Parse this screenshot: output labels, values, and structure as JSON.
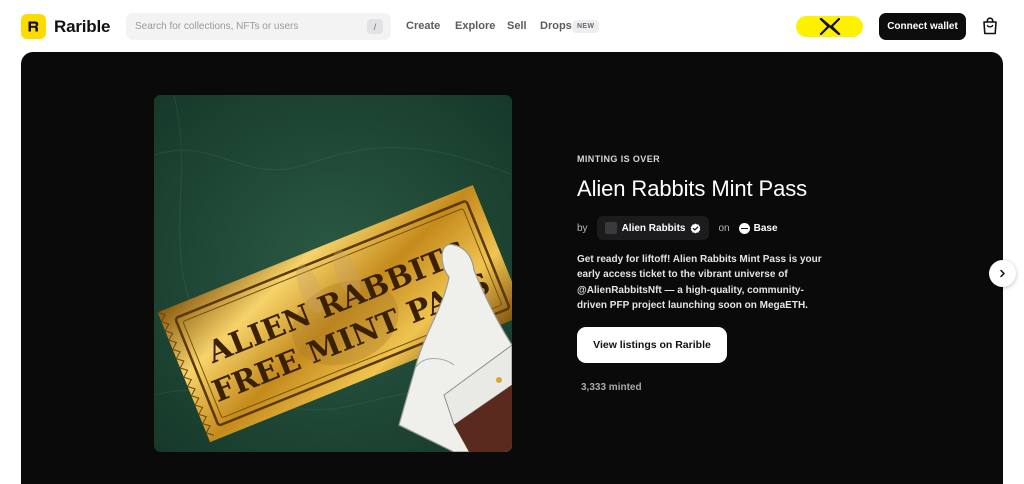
{
  "brand": {
    "name": "Rarible",
    "accent": "#FEDA03"
  },
  "search": {
    "placeholder": "Search for collections, NFTs or users",
    "shortcut": "/"
  },
  "nav": {
    "create": "Create",
    "explore": "Explore",
    "sell": "Sell",
    "drops": "Drops",
    "drops_badge": "NEW"
  },
  "header": {
    "x_button_icon": "x-logo-icon",
    "x_pill_color": "#FEF100",
    "connect_label": "Connect wallet",
    "cart_icon": "shopping-bag-icon"
  },
  "hero": {
    "status": "MINTING IS OVER",
    "title": "Alien Rabbits Mint Pass",
    "by_label": "by",
    "creator": "Alien Rabbits",
    "creator_verified": true,
    "on_label": "on",
    "chain": "Base",
    "description": "Get ready for liftoff! Alien Rabbits Mint Pass is your early access ticket to the vibrant universe of @AlienRabbitsNft — a high-quality, community-driven PFP project launching soon on MegaETH.",
    "cta_label": "View listings on Rarible",
    "minted": "3,333 minted",
    "artwork": {
      "ticket_line1": "ALIEN RABBITS",
      "ticket_line2": "FREE MINT PASS",
      "background_color": "#1f4a38",
      "ticket_color": "#d9a62a"
    },
    "next_icon": "chevron-right-icon"
  }
}
